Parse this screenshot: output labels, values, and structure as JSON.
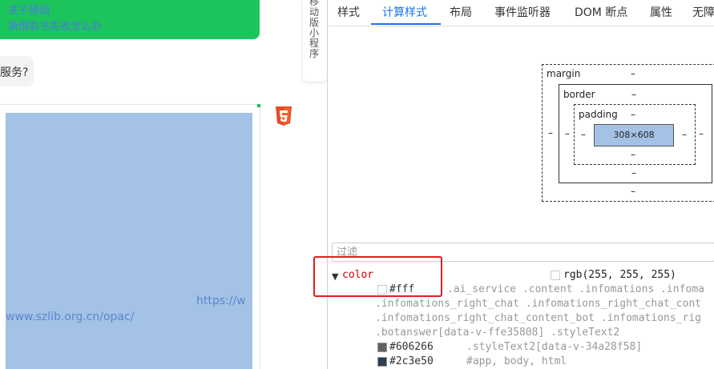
{
  "chat": {
    "green_bubble_lines": [
      "关于猜阅",
      "猜借取书失败怎么办"
    ],
    "grey_bubble_text": "服务?",
    "link_text_line1": "https://w",
    "link_text_line2": "www.szlib.org.cn/opac/",
    "side_tab_label": "移动版小程序",
    "html5_badge": "5"
  },
  "devtools": {
    "tabs": [
      "样式",
      "计算样式",
      "布局",
      "事件监听器",
      "DOM 断点",
      "属性",
      "无障"
    ],
    "active_tab": "计算样式",
    "box_model": {
      "margin_label": "margin",
      "border_label": "border",
      "padding_label": "padding",
      "content_size": "308×608",
      "dash": "–"
    },
    "filter_placeholder": "过滤",
    "property": {
      "name": "color",
      "value": "rgb(255, 255, 255)",
      "value_color": "#ffffff",
      "rules": [
        {
          "value": "#fff",
          "swatch": "#ffffff",
          "selector": ".ai_service .content .infomations .infoma"
        },
        {
          "value": "",
          "swatch": "",
          "selector": ".infomations_right_chat .infomations_right_chat_cont"
        },
        {
          "value": "",
          "swatch": "",
          "selector": ".infomations_right_chat_content_bot .infomations_rig"
        },
        {
          "value": "",
          "swatch": "",
          "selector": ".botanswer[data-v-ffe35808] .styleText2"
        },
        {
          "value": "#606266",
          "swatch": "#606266",
          "selector": ".styleText2[data-v-34a28f58]"
        },
        {
          "value": "#2c3e50",
          "swatch": "#2c3e50",
          "selector": "#app, body, html"
        }
      ]
    }
  },
  "colors": {
    "green": "#1cc45c",
    "accent_blue": "#1a73e8",
    "content_blue": "#a3c2e5",
    "highlight_red": "#e02020"
  }
}
